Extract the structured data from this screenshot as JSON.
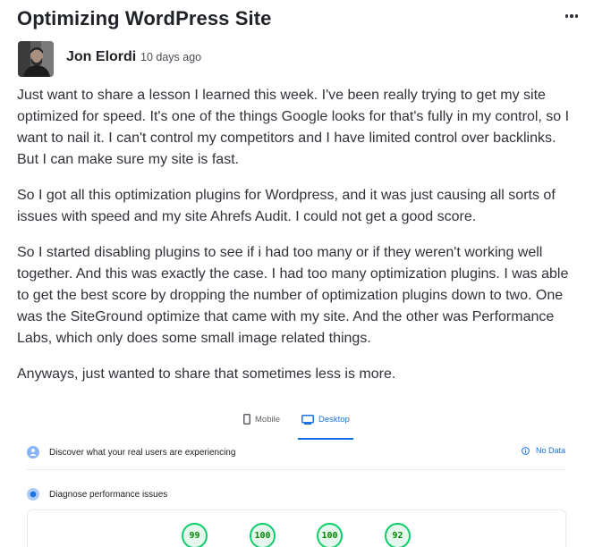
{
  "post": {
    "title": "Optimizing WordPress Site",
    "author": "Jon Elordi",
    "time": "10 days ago",
    "paragraphs": [
      "Just want to share a lesson I learned this week. I've been really trying to get my site optimized for speed. It's one of the things Google looks for that's fully in my control, so I want to nail it. I can't control my competitors and I have limited control over backlinks. But I can make sure my site is fast.",
      "So I got all this optimization plugins for Wordpress, and it was just causing all sorts of issues with speed and my site Ahrefs Audit. I could not get a good score.",
      "So I started disabling plugins to see if i had too many or if they weren't working well together. And this was exactly the case. I had too many optimization plugins. I was able to get the best score by dropping the number of optimization plugins down to two. One was the SiteGround optimize that came with my site. And the other was Performance Labs, which only does some small image related things.",
      "Anyways, just wanted to share that sometimes less is more."
    ]
  },
  "icons": {
    "menu": "more-horizontal-icon",
    "mobile": "mobile-icon",
    "desktop": "desktop-icon",
    "discover": "users-icon",
    "diagnose": "gauge-icon",
    "info": "info-icon"
  },
  "embed": {
    "tabs": [
      {
        "label": "Mobile",
        "active": false
      },
      {
        "label": "Desktop",
        "active": true
      }
    ],
    "discover_text": "Discover what your real users are experiencing",
    "no_data_text": "No Data",
    "diagnose_text": "Diagnose performance issues",
    "scores": [
      "99",
      "100",
      "100",
      "92"
    ],
    "score_color": "#0cce6b",
    "accent_color": "#1a73e8"
  }
}
